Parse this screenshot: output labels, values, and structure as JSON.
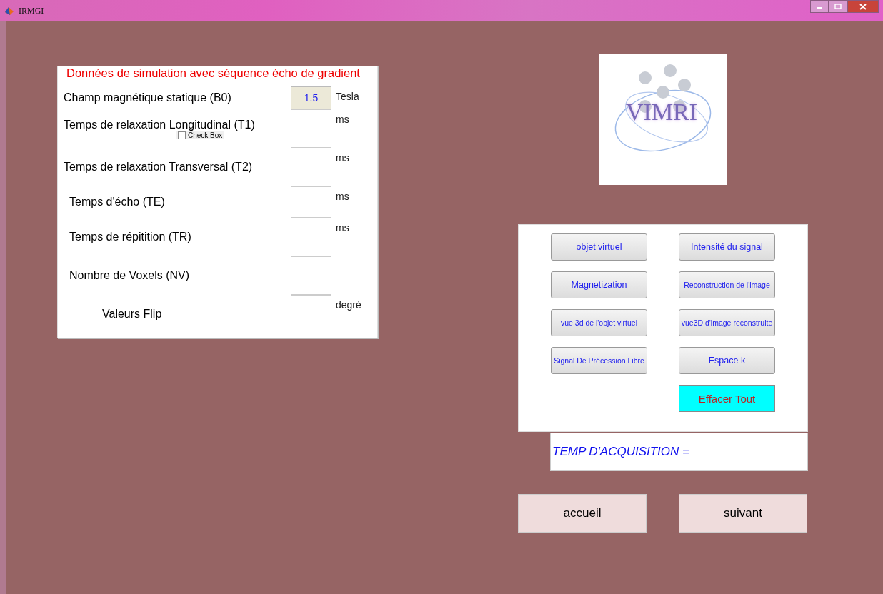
{
  "window": {
    "title": "IRMGI"
  },
  "parameters": {
    "title": "Données de simulation avec séquence écho de gradient",
    "fields": [
      {
        "label": "Champ magnétique statique (B0)",
        "value": "1.5",
        "unit": "Tesla",
        "disabled": true
      },
      {
        "label": "Temps de relaxation Longitudinal (T1)",
        "unit": "ms",
        "disabled": false
      },
      {
        "label": "Temps de relaxation Transversal (T2)",
        "unit": "ms",
        "disabled": false
      },
      {
        "label": "Temps d'écho (TE)",
        "unit": "ms",
        "disabled": false
      },
      {
        "label": "Temps de répitition (TR)",
        "unit": "ms",
        "disabled": false
      },
      {
        "label": "Nombre de Voxels (NV)",
        "disabled": false
      },
      {
        "label": "Valeurs Flip",
        "unit": "degré",
        "disabled": false
      }
    ],
    "checkbox": {
      "label": "Check Box",
      "checked": false
    }
  },
  "logo": {
    "text": "VIMRI"
  },
  "actions": [
    {
      "label": "objet virtuel",
      "kind": "normal"
    },
    {
      "label": "Intensité du signal",
      "kind": "normal"
    },
    {
      "label": "Magnetization",
      "kind": "normal"
    },
    {
      "label": "Reconstruction de l'image",
      "kind": "normal"
    },
    {
      "label": "vue 3d de l'objet virtuel",
      "kind": "normal"
    },
    {
      "label": "vue3D d'image reconstruite",
      "kind": "normal"
    },
    {
      "label": "Signal De Précession Libre",
      "kind": "normal"
    },
    {
      "label": "Espace k",
      "kind": "normal"
    },
    {
      "label": "Effacer Tout",
      "kind": "highlight"
    }
  ],
  "acquisition": {
    "label": "TEMP D'ACQUISITION ="
  },
  "navigation": [
    "accueil",
    "suivant"
  ]
}
